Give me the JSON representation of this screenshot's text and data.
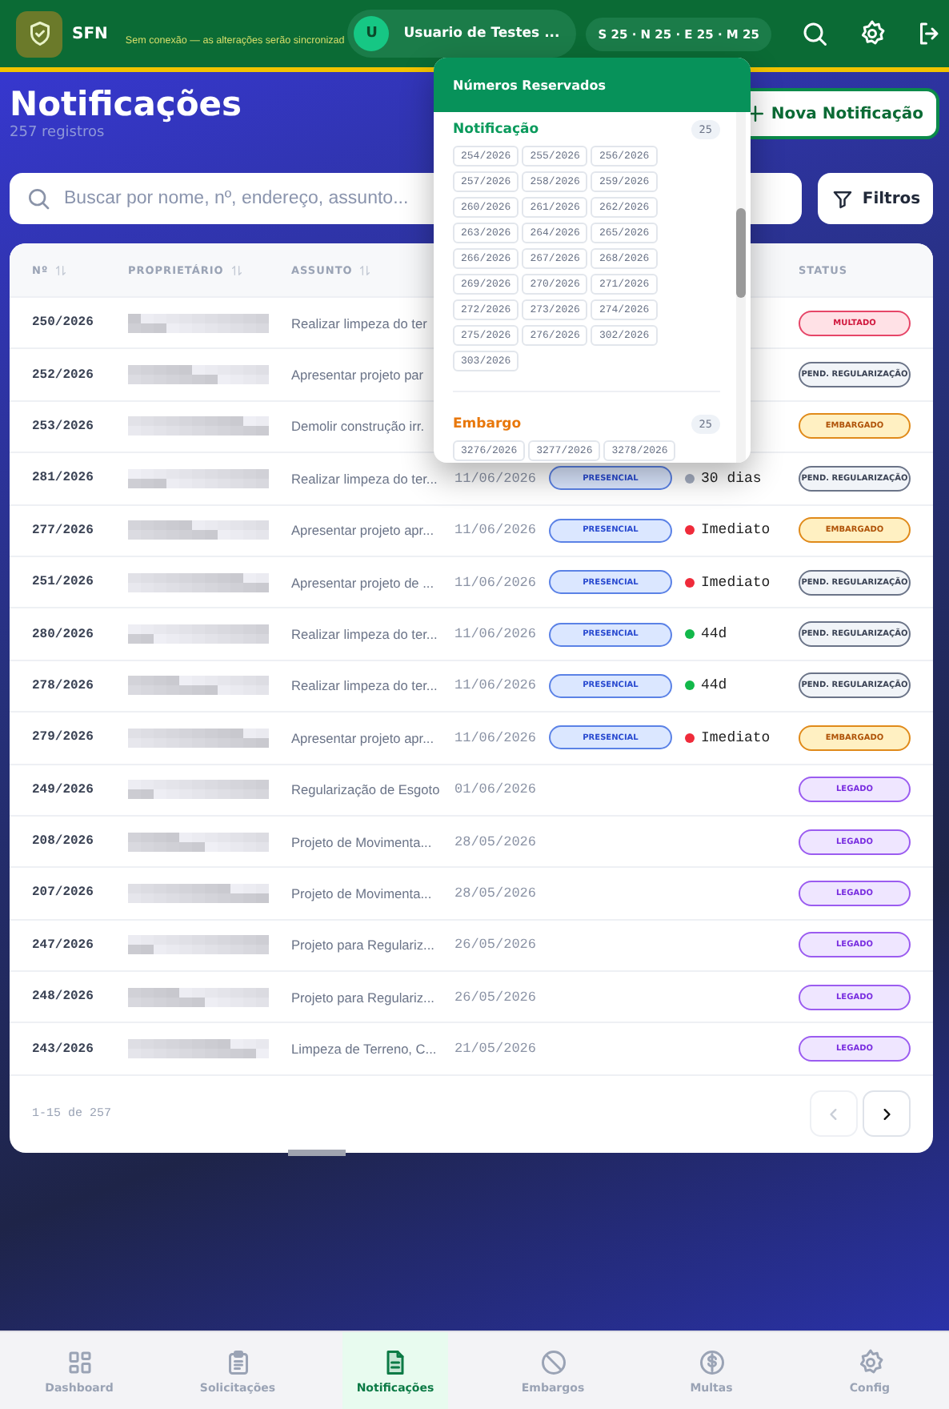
{
  "topbar": {
    "app_name": "SFN",
    "sync_message": "Sem conexão — as alterações serão sincronizad",
    "user": {
      "initial": "U",
      "name": "Usuario de Testes ..."
    },
    "counters": "S 25 · N 25 · E 25 · M 25"
  },
  "header": {
    "title": "Notificações",
    "subtitle": "257 registros",
    "new_button": "Nova Notificação"
  },
  "search": {
    "placeholder": "Buscar por nome, nº, endereço, assunto..."
  },
  "filter_button": "Filtros",
  "table": {
    "columns": [
      {
        "label": "Nº",
        "sortable": true
      },
      {
        "label": "PROPRIETÁRIO",
        "sortable": true
      },
      {
        "label": "ASSUNTO",
        "sortable": true
      },
      {
        "label": "STATUS",
        "sortable": false
      }
    ],
    "rows": [
      {
        "number": "250/2026",
        "owner": {
          "kind": "blurred"
        },
        "subject": "Realizar limpeza do ter",
        "status": {
          "label": "MULTADO",
          "kind": "multado"
        }
      },
      {
        "number": "252/2026",
        "owner": {
          "kind": "blurred"
        },
        "subject": "Apresentar projeto par",
        "status": {
          "label": "PEND. REGULARIZAÇÃO",
          "kind": "pending"
        }
      },
      {
        "number": "253/2026",
        "owner": {
          "kind": "blurred"
        },
        "subject": "Demolir construção irr.",
        "status": {
          "label": "EMBARGADO",
          "kind": "embargado"
        }
      },
      {
        "number": "281/2026",
        "owner": {
          "kind": "blurred"
        },
        "subject": "Realizar limpeza do ter...",
        "date": "11/06/2026",
        "type": "PRESENCIAL",
        "deadline": {
          "text": "30 dias",
          "color": "#a3acbf"
        },
        "status": {
          "label": "PEND. REGULARIZAÇÃO",
          "kind": "pending"
        }
      },
      {
        "number": "277/2026",
        "owner": {
          "kind": "blurred"
        },
        "subject": "Apresentar projeto apr...",
        "date": "11/06/2026",
        "type": "PRESENCIAL",
        "deadline": {
          "text": "Imediato",
          "color": "#ef2b3a"
        },
        "status": {
          "label": "EMBARGADO",
          "kind": "embargado"
        }
      },
      {
        "number": "251/2026",
        "owner": {
          "kind": "blurred"
        },
        "subject": "Apresentar projeto de ...",
        "date": "11/06/2026",
        "type": "PRESENCIAL",
        "deadline": {
          "text": "Imediato",
          "color": "#ef2b3a"
        },
        "status": {
          "label": "PEND. REGULARIZAÇÃO",
          "kind": "pending"
        }
      },
      {
        "number": "280/2026",
        "owner": {
          "kind": "blurred"
        },
        "subject": "Realizar limpeza do ter...",
        "date": "11/06/2026",
        "type": "PRESENCIAL",
        "deadline": {
          "text": "44d",
          "color": "#12b84a"
        },
        "status": {
          "label": "PEND. REGULARIZAÇÃO",
          "kind": "pending"
        }
      },
      {
        "number": "278/2026",
        "owner": {
          "kind": "blurred"
        },
        "subject": "Realizar limpeza do ter...",
        "date": "11/06/2026",
        "type": "PRESENCIAL",
        "deadline": {
          "text": "44d",
          "color": "#12b84a"
        },
        "status": {
          "label": "PEND. REGULARIZAÇÃO",
          "kind": "pending"
        }
      },
      {
        "number": "279/2026",
        "owner": {
          "kind": "blurred"
        },
        "subject": "Apresentar projeto apr...",
        "date": "11/06/2026",
        "type": "PRESENCIAL",
        "deadline": {
          "text": "Imediato",
          "color": "#ef2b3a"
        },
        "status": {
          "label": "EMBARGADO",
          "kind": "embargado"
        }
      },
      {
        "number": "249/2026",
        "owner": {
          "kind": "blurred"
        },
        "subject": "Regularização de Esgoto",
        "date": "01/06/2026",
        "status": {
          "label": "LEGADO",
          "kind": "legado"
        }
      },
      {
        "number": "208/2026",
        "owner": {
          "kind": "blurred"
        },
        "subject": "Projeto de Movimenta...",
        "date": "28/05/2026",
        "status": {
          "label": "LEGADO",
          "kind": "legado"
        }
      },
      {
        "number": "207/2026",
        "owner": {
          "kind": "blurred"
        },
        "subject": "Projeto de Movimenta...",
        "date": "28/05/2026",
        "status": {
          "label": "LEGADO",
          "kind": "legado"
        }
      },
      {
        "number": "247/2026",
        "owner": {
          "kind": "blurred"
        },
        "subject": "Projeto para Regulariz...",
        "date": "26/05/2026",
        "status": {
          "label": "LEGADO",
          "kind": "legado"
        }
      },
      {
        "number": "248/2026",
        "owner": {
          "kind": "blurred"
        },
        "subject": "Projeto para Regulariz...",
        "date": "26/05/2026",
        "status": {
          "label": "LEGADO",
          "kind": "legado"
        }
      },
      {
        "number": "243/2026",
        "owner": {
          "kind": "blurred"
        },
        "subject": "Limpeza de Terreno, C...",
        "date": "21/05/2026",
        "status": {
          "label": "LEGADO",
          "kind": "legado"
        }
      }
    ],
    "range": "1-15 de 257",
    "prev_disabled": true,
    "next_disabled": false
  },
  "reserved_popup": {
    "title": "Números Reservados",
    "sections": [
      {
        "title": "Notificação",
        "color": "#0a9a5c",
        "count": "25",
        "numbers": [
          "254/2026",
          "255/2026",
          "256/2026",
          "257/2026",
          "258/2026",
          "259/2026",
          "260/2026",
          "261/2026",
          "262/2026",
          "263/2026",
          "264/2026",
          "265/2026",
          "266/2026",
          "267/2026",
          "268/2026",
          "269/2026",
          "270/2026",
          "271/2026",
          "272/2026",
          "273/2026",
          "274/2026",
          "275/2026",
          "276/2026",
          "302/2026",
          "303/2026"
        ]
      },
      {
        "title": "Embargo",
        "color": "#e8780c",
        "count": "25",
        "numbers": [
          "3276/2026",
          "3277/2026",
          "3278/2026"
        ]
      }
    ]
  },
  "bottom_nav": [
    {
      "label": "Dashboard",
      "selected": false
    },
    {
      "label": "Solicitações",
      "selected": false
    },
    {
      "label": "Notificações",
      "selected": true
    },
    {
      "label": "Embargos",
      "selected": false
    },
    {
      "label": "Multas",
      "selected": false
    },
    {
      "label": "Config",
      "selected": false
    }
  ]
}
